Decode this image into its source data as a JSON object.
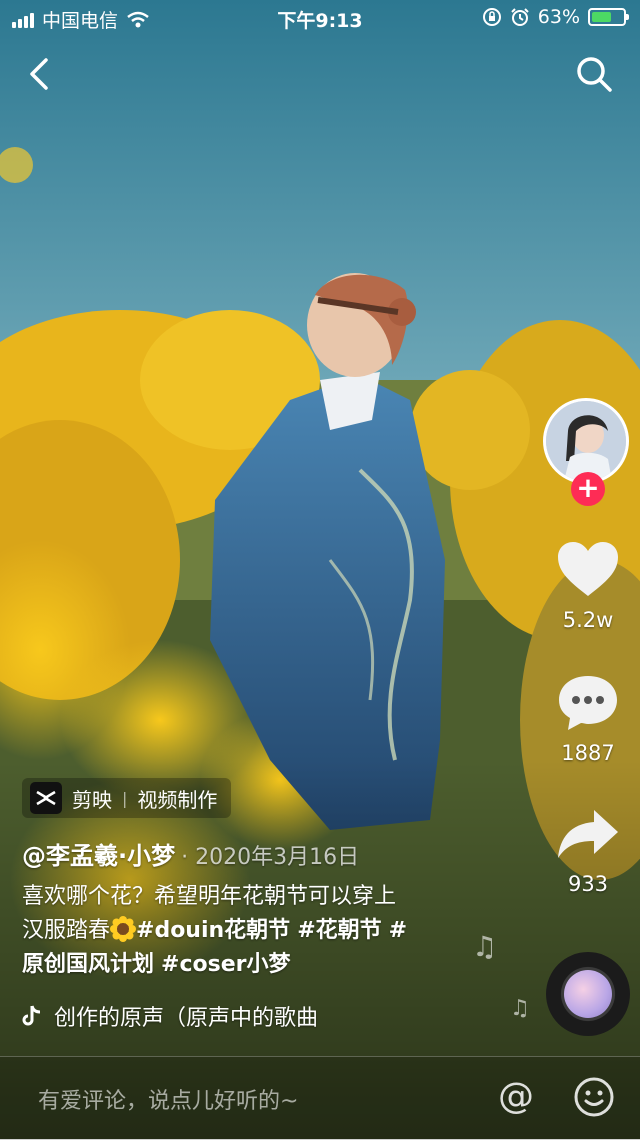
{
  "status_bar": {
    "carrier": "中国电信",
    "time": "下午9:13",
    "battery_percent": "63%",
    "battery_level": 0.63
  },
  "header": {
    "back_icon": "chevron-left-icon",
    "search_icon": "search-icon"
  },
  "rail": {
    "avatar_icon": "user-avatar",
    "follow_label": "+",
    "like_icon": "heart-icon",
    "like_count": "5.2w",
    "comment_icon": "comment-bubble-icon",
    "comment_count": "1887",
    "share_icon": "share-arrow-icon",
    "share_count": "933",
    "disc_icon": "music-disc-icon"
  },
  "badge": {
    "app_name": "剪映",
    "separator": "|",
    "label": "视频制作"
  },
  "post": {
    "author": "@李孟羲·小梦",
    "date": "· 2020年3月16日",
    "text_line1": "喜欢哪个花？希望明年花朝节可以穿上",
    "text_line2_prefix": "汉服踏春",
    "tag1": "#douin花朝节",
    "tag2": "#花朝节",
    "tag3_hash": "#",
    "tag3": "原创国风计划",
    "tag4": "#coser小梦"
  },
  "music": {
    "icon": "tiktok-note-icon",
    "title": "创作的原声（原声中的歌曲"
  },
  "comment_bar": {
    "placeholder": "有爱评论，说点儿好听的~",
    "at_label": "@",
    "emoji_icon": "smiley-icon"
  },
  "colors": {
    "sky_top": "#2e7c95",
    "sky_mid": "#7fb3c2",
    "flower_yellow": "#f2c21a",
    "follow_red": "#fe2c55",
    "robe_blue": "#2f5f8c"
  }
}
